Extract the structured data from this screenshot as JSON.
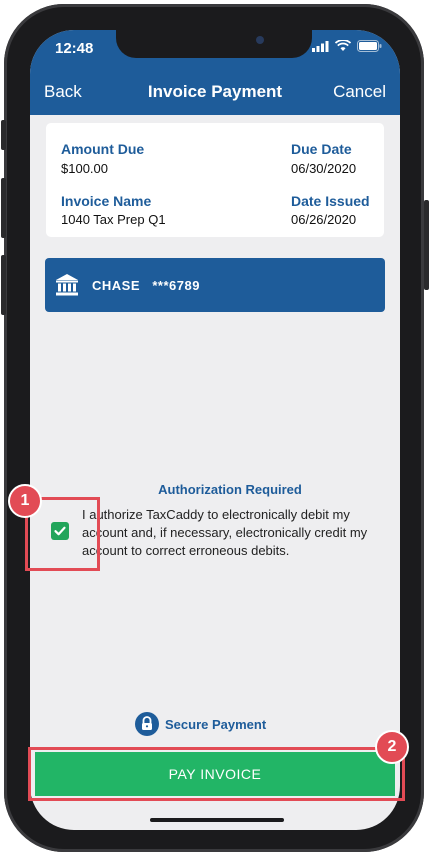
{
  "status_bar": {
    "time": "12:48"
  },
  "nav": {
    "back_label": "Back",
    "title": "Invoice Payment",
    "cancel_label": "Cancel"
  },
  "invoice": {
    "amount_due_label": "Amount Due",
    "amount_due_value": "$100.00",
    "due_date_label": "Due Date",
    "due_date_value": "06/30/2020",
    "invoice_name_label": "Invoice Name",
    "invoice_name_value": "1040 Tax Prep Q1",
    "date_issued_label": "Date Issued",
    "date_issued_value": "06/26/2020"
  },
  "account": {
    "name": "CHASE   ***6789",
    "icon": "bank-icon"
  },
  "authorization": {
    "title": "Authorization Required",
    "checked": true,
    "text": "I authorize TaxCaddy to electronically debit my account and, if necessary, electronically credit my account to correct erroneous debits."
  },
  "secure": {
    "label": "Secure Payment",
    "icon": "lock-icon"
  },
  "pay_button": {
    "label": "PAY INVOICE"
  },
  "annotations": {
    "badge_1": "1",
    "badge_2": "2"
  },
  "colors": {
    "brand_blue": "#1e5c9a",
    "pay_green": "#22b566",
    "check_green": "#22a55b",
    "highlight_red": "#e24b55"
  }
}
